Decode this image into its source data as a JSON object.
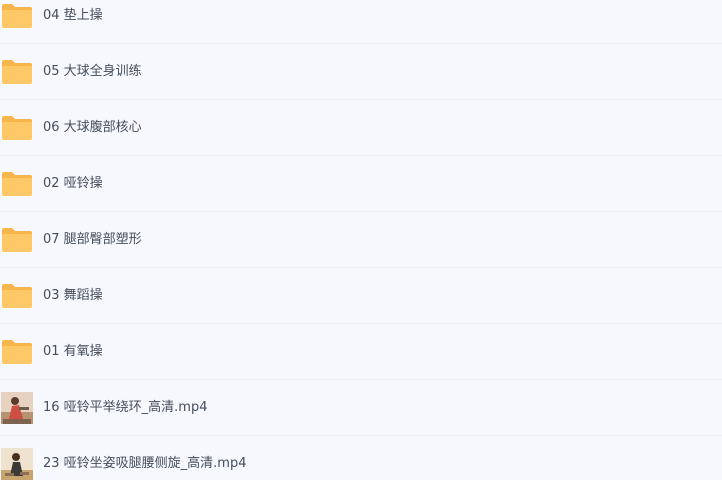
{
  "items": [
    {
      "name": "04 垫上操",
      "type": "folder",
      "icon": "folder-icon"
    },
    {
      "name": "05 大球全身训练",
      "type": "folder",
      "icon": "folder-icon"
    },
    {
      "name": "06 大球腹部核心",
      "type": "folder",
      "icon": "folder-icon"
    },
    {
      "name": "02 哑铃操",
      "type": "folder",
      "icon": "folder-icon"
    },
    {
      "name": "07 腿部臀部塑形",
      "type": "folder",
      "icon": "folder-icon"
    },
    {
      "name": "03 舞蹈操",
      "type": "folder",
      "icon": "folder-icon"
    },
    {
      "name": "01 有氧操",
      "type": "folder",
      "icon": "folder-icon"
    },
    {
      "name": "16 哑铃平举绕环_高清.mp4",
      "type": "video",
      "icon": "video-thumbnail"
    },
    {
      "name": "23 哑铃坐姿吸腿腰侧旋_高清.mp4",
      "type": "video",
      "icon": "video-thumbnail"
    }
  ],
  "colors": {
    "background": "#f7f8fd",
    "folder": "#ffc867",
    "folder_back": "#f7b54b",
    "text": "#454d5a",
    "divider": "#edeff6"
  }
}
